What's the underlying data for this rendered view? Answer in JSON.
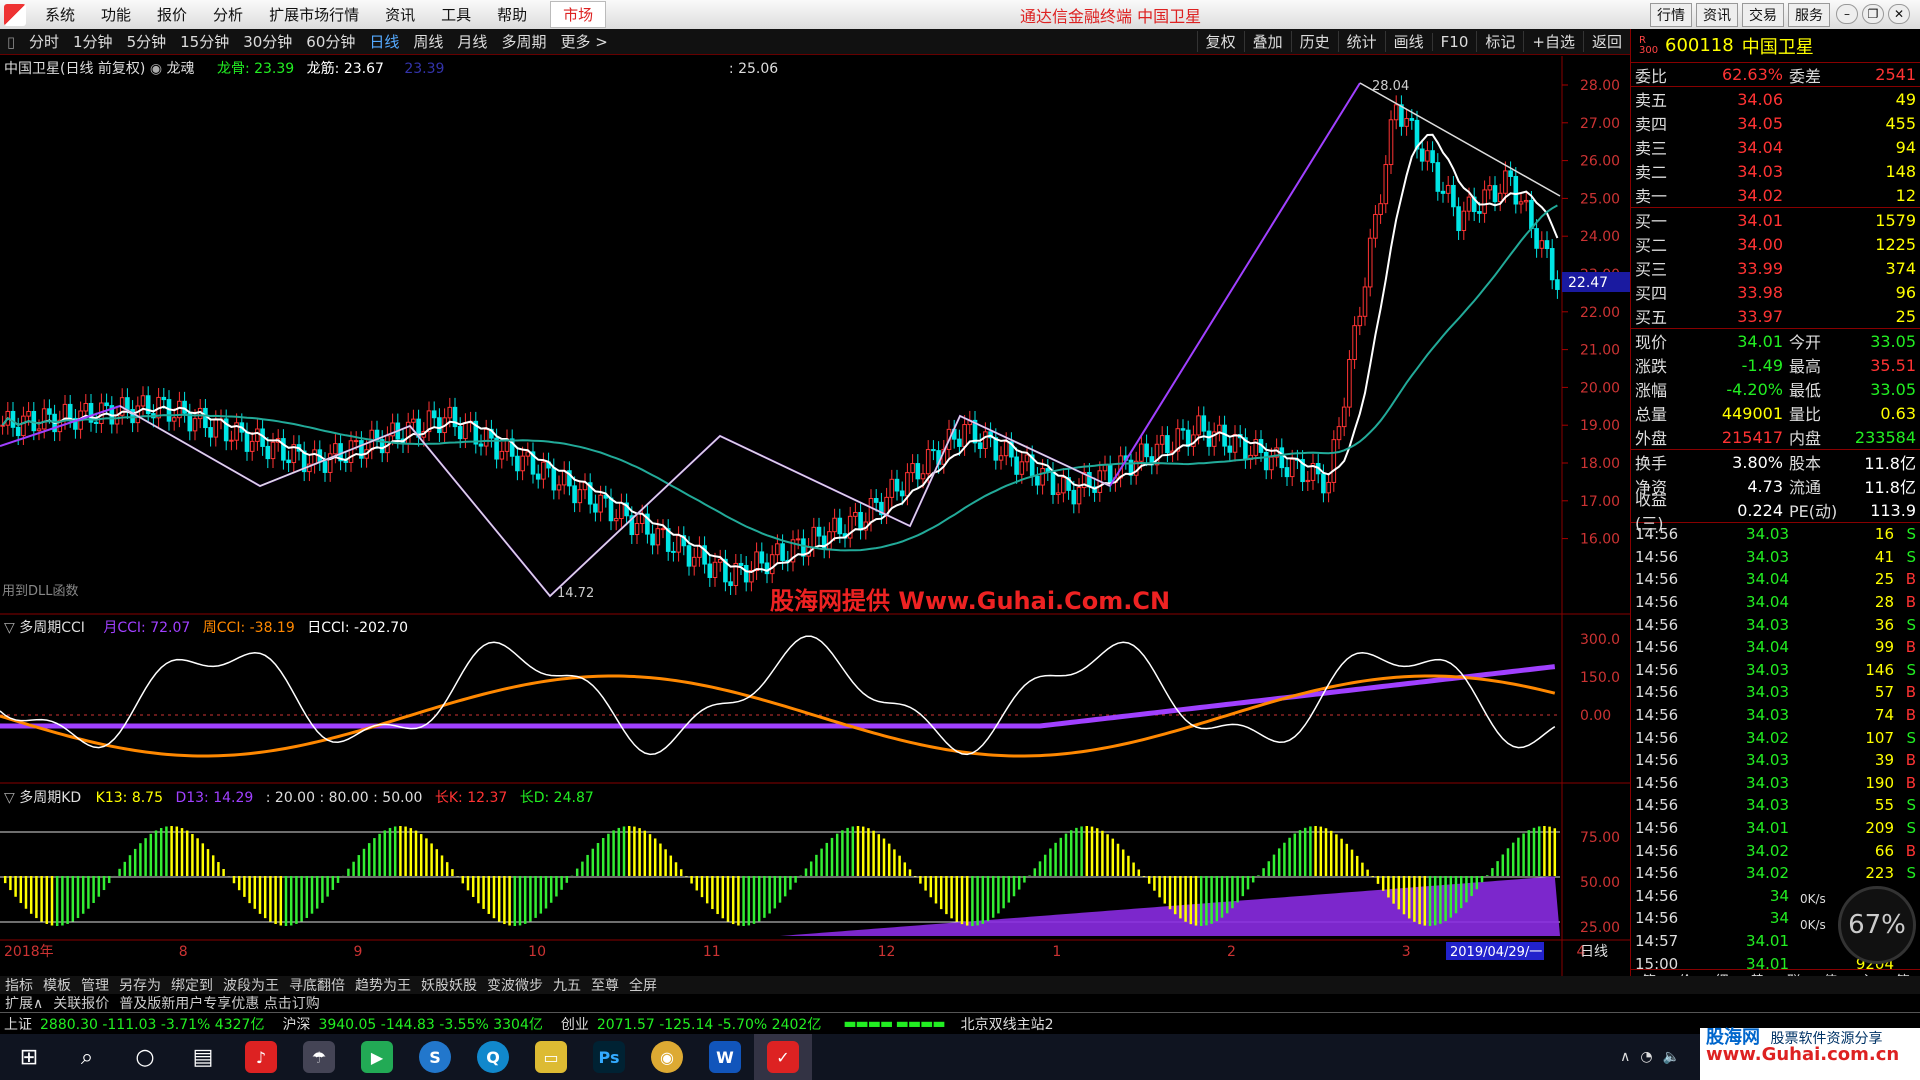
{
  "menubar": {
    "items": [
      "系统",
      "功能",
      "报价",
      "分析",
      "扩展市场行情",
      "资讯",
      "工具",
      "帮助"
    ],
    "market": "市场",
    "center_title": "通达信金融终端  中国卫星",
    "right_buttons": [
      "行情",
      "资讯",
      "交易",
      "服务"
    ]
  },
  "periodbar": {
    "periods": [
      "分时",
      "1分钟",
      "5分钟",
      "15分钟",
      "30分钟",
      "60分钟",
      "日线",
      "周线",
      "月线",
      "多周期",
      "更多 >"
    ],
    "active": "日线",
    "tools": [
      "复权",
      "叠加",
      "历史",
      "统计",
      "画线",
      "F10",
      "标记",
      "+自选",
      "返回"
    ]
  },
  "main_chart": {
    "header_name": "中国卫星(日线 前复权)",
    "header_indicator": "龙魂",
    "longgu": "龙骨: 23.39",
    "longjin": "龙筋: 23.67",
    "hidden_val": "23.39",
    "extra": ": 25.06",
    "high_label": "28.04",
    "low_label": "14.72",
    "current_price_tag": "22.47",
    "dll_text": "用到DLL函数",
    "y_ticks": [
      "28.00",
      "27.00",
      "26.00",
      "25.00",
      "24.00",
      "23.00",
      "22.00",
      "21.00",
      "20.00",
      "19.00",
      "18.00",
      "17.00",
      "16.00"
    ]
  },
  "cci_panel": {
    "title": "多周期CCI",
    "month": "月CCI: 72.07",
    "week": "周CCI: -38.19",
    "day": "日CCI: -202.70",
    "y_ticks": [
      "300.0",
      "150.0",
      "0.00"
    ]
  },
  "kd_panel": {
    "title": "多周期KD",
    "k13": "K13: 8.75",
    "d13": "D13: 14.29",
    "levels": ": 20.00  : 80.00  : 50.00",
    "longk": "长K: 12.37",
    "longd": "长D: 24.87",
    "y_ticks": [
      "75.00",
      "50.00",
      "25.00"
    ]
  },
  "xaxis": {
    "labels": [
      "2018年",
      "8",
      "9",
      "10",
      "11",
      "12",
      "1",
      "2",
      "3",
      "4"
    ],
    "date_box": "2019/04/29/一",
    "period_label": "日线"
  },
  "right_panel": {
    "code": "600118",
    "name": "中国卫星",
    "weibi": {
      "label": "委比",
      "value": "62.63%",
      "label2": "委差",
      "value2": "2541"
    },
    "sells": [
      {
        "label": "卖五",
        "price": "34.06",
        "qty": "49"
      },
      {
        "label": "卖四",
        "price": "34.05",
        "qty": "455"
      },
      {
        "label": "卖三",
        "price": "34.04",
        "qty": "94"
      },
      {
        "label": "卖二",
        "price": "34.03",
        "qty": "148"
      },
      {
        "label": "卖一",
        "price": "34.02",
        "qty": "12"
      }
    ],
    "buys": [
      {
        "label": "买一",
        "price": "34.01",
        "qty": "1579"
      },
      {
        "label": "买二",
        "price": "34.00",
        "qty": "1225"
      },
      {
        "label": "买三",
        "price": "33.99",
        "qty": "374"
      },
      {
        "label": "买四",
        "price": "33.98",
        "qty": "96"
      },
      {
        "label": "买五",
        "price": "33.97",
        "qty": "25"
      }
    ],
    "stats": [
      {
        "l": "现价",
        "v": "34.01",
        "vc": "green",
        "l2": "今开",
        "v2": "33.05",
        "v2c": "green"
      },
      {
        "l": "涨跌",
        "v": "-1.49",
        "vc": "green",
        "l2": "最高",
        "v2": "35.51",
        "v2c": "red"
      },
      {
        "l": "涨幅",
        "v": "-4.20%",
        "vc": "green",
        "l2": "最低",
        "v2": "33.05",
        "v2c": "green"
      },
      {
        "l": "总量",
        "v": "449001",
        "vc": "yel",
        "l2": "量比",
        "v2": "0.63",
        "v2c": "yel"
      },
      {
        "l": "外盘",
        "v": "215417",
        "vc": "red",
        "l2": "内盘",
        "v2": "233584",
        "v2c": "green"
      }
    ],
    "stats2": [
      {
        "l": "换手",
        "v": "3.80%",
        "l2": "股本",
        "v2": "11.8亿"
      },
      {
        "l": "净资",
        "v": "4.73",
        "l2": "流通",
        "v2": "11.8亿"
      },
      {
        "l": "收益(三)",
        "v": "0.224",
        "l2": "PE(动)",
        "v2": "113.9"
      }
    ],
    "ticks": [
      {
        "t": "14:56",
        "p": "34.03",
        "n": "16",
        "s": "S"
      },
      {
        "t": "14:56",
        "p": "34.03",
        "n": "41",
        "s": "S"
      },
      {
        "t": "14:56",
        "p": "34.04",
        "n": "25",
        "s": "B"
      },
      {
        "t": "14:56",
        "p": "34.04",
        "n": "28",
        "s": "B"
      },
      {
        "t": "14:56",
        "p": "34.03",
        "n": "36",
        "s": "S"
      },
      {
        "t": "14:56",
        "p": "34.04",
        "n": "99",
        "s": "B"
      },
      {
        "t": "14:56",
        "p": "34.03",
        "n": "146",
        "s": "S"
      },
      {
        "t": "14:56",
        "p": "34.03",
        "n": "57",
        "s": "B"
      },
      {
        "t": "14:56",
        "p": "34.03",
        "n": "74",
        "s": "B"
      },
      {
        "t": "14:56",
        "p": "34.02",
        "n": "107",
        "s": "S"
      },
      {
        "t": "14:56",
        "p": "34.03",
        "n": "39",
        "s": "B"
      },
      {
        "t": "14:56",
        "p": "34.03",
        "n": "190",
        "s": "B"
      },
      {
        "t": "14:56",
        "p": "34.03",
        "n": "55",
        "s": "S"
      },
      {
        "t": "14:56",
        "p": "34.01",
        "n": "209",
        "s": "S"
      },
      {
        "t": "14:56",
        "p": "34.02",
        "n": "66",
        "s": "B"
      },
      {
        "t": "14:56",
        "p": "34.02",
        "n": "223",
        "s": "S"
      },
      {
        "t": "14:56",
        "p": "34",
        "n": "",
        "s": ""
      },
      {
        "t": "14:56",
        "p": "34",
        "n": "",
        "s": ""
      },
      {
        "t": "14:57",
        "p": "34.01",
        "n": "",
        "s": ""
      },
      {
        "t": "15:00",
        "p": "34.01",
        "n": "9204",
        "s": ""
      }
    ],
    "bottom_tabs": [
      "笔",
      "价",
      "细",
      "势",
      "联",
      "值",
      "主",
      "筹"
    ]
  },
  "toolbar1": [
    "指标",
    "模板",
    "管理",
    "另存为",
    "绑定到",
    "波段为王",
    "寻底翻倍",
    "趋势为王",
    "妖股妖股",
    "变波微步",
    "九五",
    "至尊",
    "全屏"
  ],
  "toolbar2": [
    "扩展∧",
    "关联报价",
    "普及版新用户专享优惠 点击订购"
  ],
  "indexbar": {
    "sh": "上证",
    "sh_val": "2880.30 -111.03 -3.71% 4327亿",
    "sz": "沪深",
    "sz_val": "3940.05 -144.83 -3.55% 3304亿",
    "cy": "创业",
    "cy_val": "2071.57 -125.14 -5.70% 2402亿",
    "server": "北京双线主站2"
  },
  "watermark": "股海网提供  Www.Guhai.Com.CN",
  "speed": {
    "pct": "67%",
    "up": "0K/s",
    "down": "0K/s"
  },
  "tray": {
    "brand": "股海网",
    "tagline": "股票软件资源分享",
    "url": "www.Guhai.com.cn"
  },
  "colors": {
    "up": "#ff3333",
    "down": "#00e5e5",
    "ma_white": "#ffffff",
    "ma_green": "#2a9",
    "purple": "#a040ff"
  }
}
